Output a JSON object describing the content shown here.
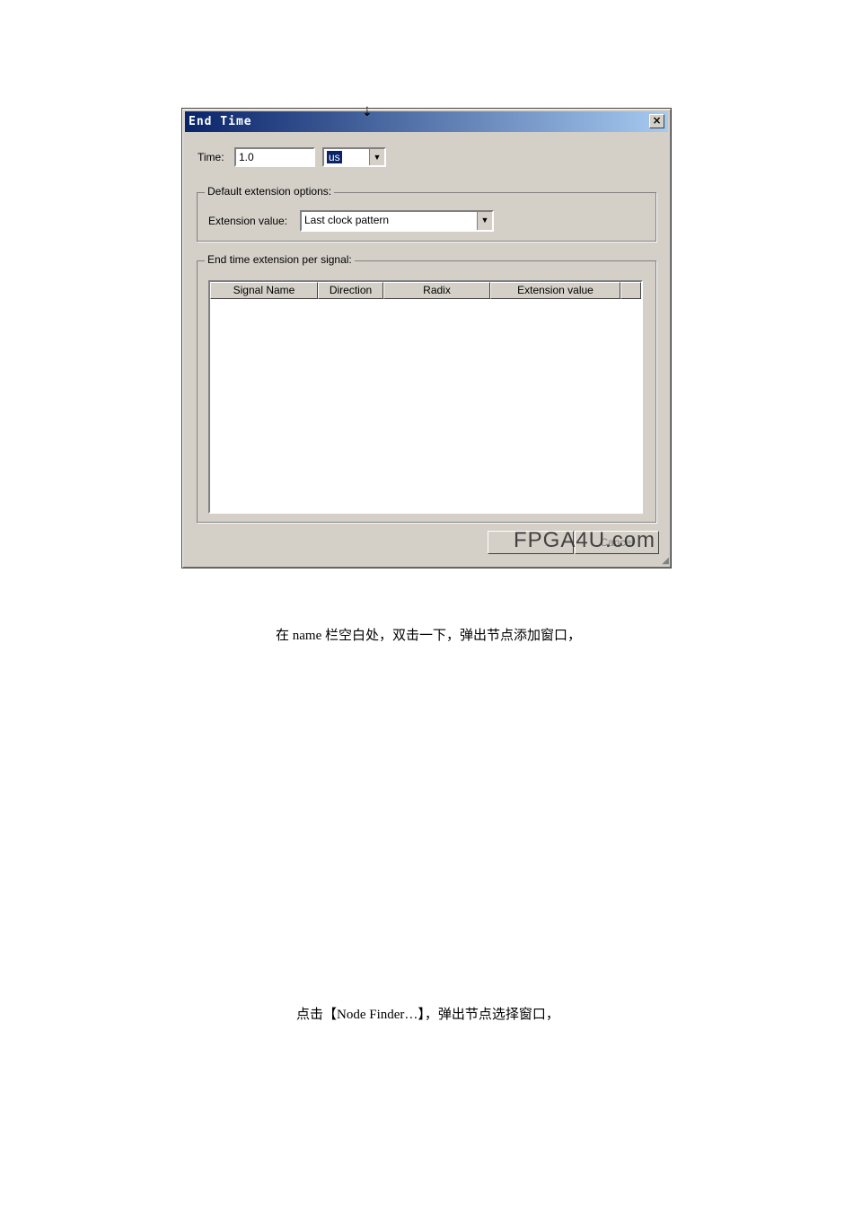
{
  "dialog": {
    "title": "End Time",
    "close_glyph": "×",
    "time_label": "Time:",
    "time_value": "1.0",
    "time_unit": "us",
    "default_group_label": "Default extension options:",
    "extension_label": "Extension value:",
    "extension_value": "Last clock pattern",
    "per_signal_group_label": "End time extension per signal:",
    "table_columns": [
      "Signal Name",
      "Direction",
      "Radix",
      "Extension value"
    ],
    "ok_label": "OK",
    "cancel_label": "Cancel",
    "watermark": "FPGA4U.com"
  },
  "paragraphs": {
    "p1": "在 name 栏空白处，双击一下，弹出节点添加窗口，",
    "p2": "点击【Node Finder…】，弹出节点选择窗口，"
  },
  "icons": {
    "dropdown": "▼",
    "cursor": "⇣"
  }
}
